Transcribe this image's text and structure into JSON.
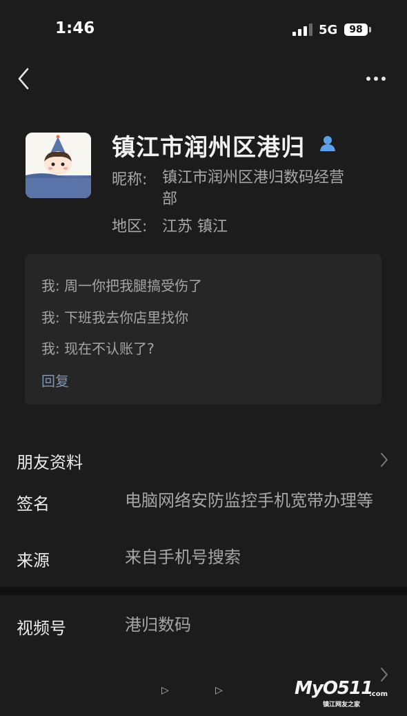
{
  "status_bar": {
    "time": "1:46",
    "network": "5G",
    "battery": "98"
  },
  "profile": {
    "name": "镇江市润州区港归",
    "nickname_label": "昵称:",
    "nickname": "镇江市润州区港归数码经营部",
    "region_label": "地区:",
    "region": "江苏 镇江"
  },
  "messages": {
    "items": [
      "我: 周一你把我腿搞受伤了",
      "我: 下班我去你店里找你",
      "我: 现在不认账了?"
    ],
    "reply_label": "回复"
  },
  "info": {
    "friend_profile_label": "朋友资料",
    "signature_label": "签名",
    "signature_value": "电脑网络安防监控手机宽带办理等",
    "source_label": "来源",
    "source_value": "来自手机号搜索",
    "channels_label": "视频号",
    "channels_value": "港归数码"
  },
  "watermark": {
    "logo": "MyO511",
    "domain": ".com",
    "tagline": "镇江网友之家"
  },
  "colors": {
    "background": "#1c1c1c",
    "card": "#262626",
    "link": "#7d95b6"
  }
}
